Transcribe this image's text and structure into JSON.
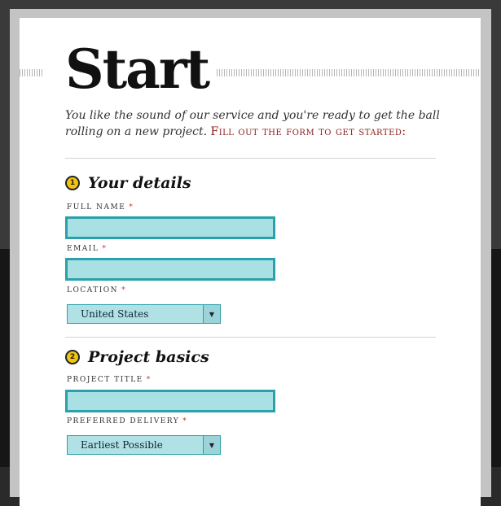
{
  "header": {
    "title": "Start"
  },
  "intro": {
    "text": "You like the sound of our service and you're ready to get the ball rolling on a new project.",
    "cta": "Fill out the form to get started:"
  },
  "sections": [
    {
      "number": "1",
      "title": "Your details",
      "fields": {
        "full_name": {
          "label": "FULL NAME",
          "required_mark": "*",
          "value": ""
        },
        "email": {
          "label": "EMAIL",
          "required_mark": "*",
          "value": ""
        },
        "location": {
          "label": "LOCATION",
          "required_mark": "*",
          "selected": "United States"
        }
      }
    },
    {
      "number": "2",
      "title": "Project basics",
      "fields": {
        "project_title": {
          "label": "PROJECT TITLE",
          "required_mark": "*",
          "value": ""
        },
        "preferred_delivery": {
          "label": "PREFERRED DELIVERY",
          "required_mark": "*",
          "selected": "Earliest Possible"
        }
      }
    }
  ],
  "colors": {
    "accent_field": "#a9e0e3",
    "field_border": "#2aa0aa",
    "cta_red": "#8b1a1a",
    "step_badge": "#f1c40f"
  },
  "icons": {
    "step_badge": "numbered-circle",
    "select_arrow": "triangle-down"
  }
}
